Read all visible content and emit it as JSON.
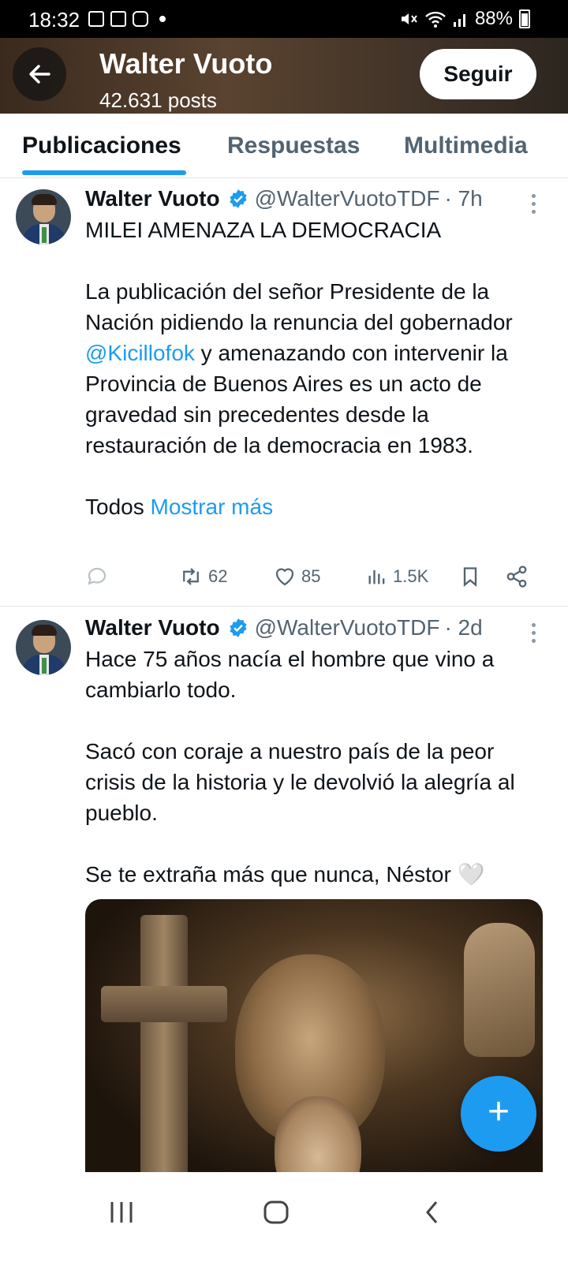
{
  "status_bar": {
    "time": "18:32",
    "battery": "88%"
  },
  "profile_header": {
    "name": "Walter Vuoto",
    "posts": "42.631 posts",
    "follow_label": "Seguir"
  },
  "tabs": [
    {
      "label": "Publicaciones",
      "active": true
    },
    {
      "label": "Respuestas",
      "active": false
    },
    {
      "label": "Multimedia",
      "active": false
    }
  ],
  "tweets": [
    {
      "name": "Walter Vuoto",
      "handle": "@WalterVuotoTDF",
      "time": "· 7h",
      "line1": "MILEI AMENAZA LA DEMOCRACIA",
      "para2_before": "La publicación del señor Presidente de la Nación pidiendo la renuncia del gobernador ",
      "mention": "@Kicillofok",
      "para2_after": "  y amenazando con intervenir la Provincia de Buenos Aires es un acto de gravedad sin precedentes desde la restauración de la democracia en 1983.",
      "para3": "Todos ",
      "show_more": "Mostrar más",
      "retweets": "62",
      "likes": "85",
      "views": "1.5K"
    },
    {
      "name": "Walter Vuoto",
      "handle": "@WalterVuotoTDF",
      "time": "· 2d",
      "para1": "Hace 75 años nacía el hombre que vino a cambiarlo todo.",
      "para2": "Sacó con coraje a nuestro país de la peor crisis de la historia y le devolvió la alegría al pueblo.",
      "para3": "Se te extraña más que nunca, Néstor 🤍"
    }
  ],
  "colors": {
    "accent": "#1d9bf0",
    "text": "#0f1419",
    "secondary": "#536471"
  }
}
